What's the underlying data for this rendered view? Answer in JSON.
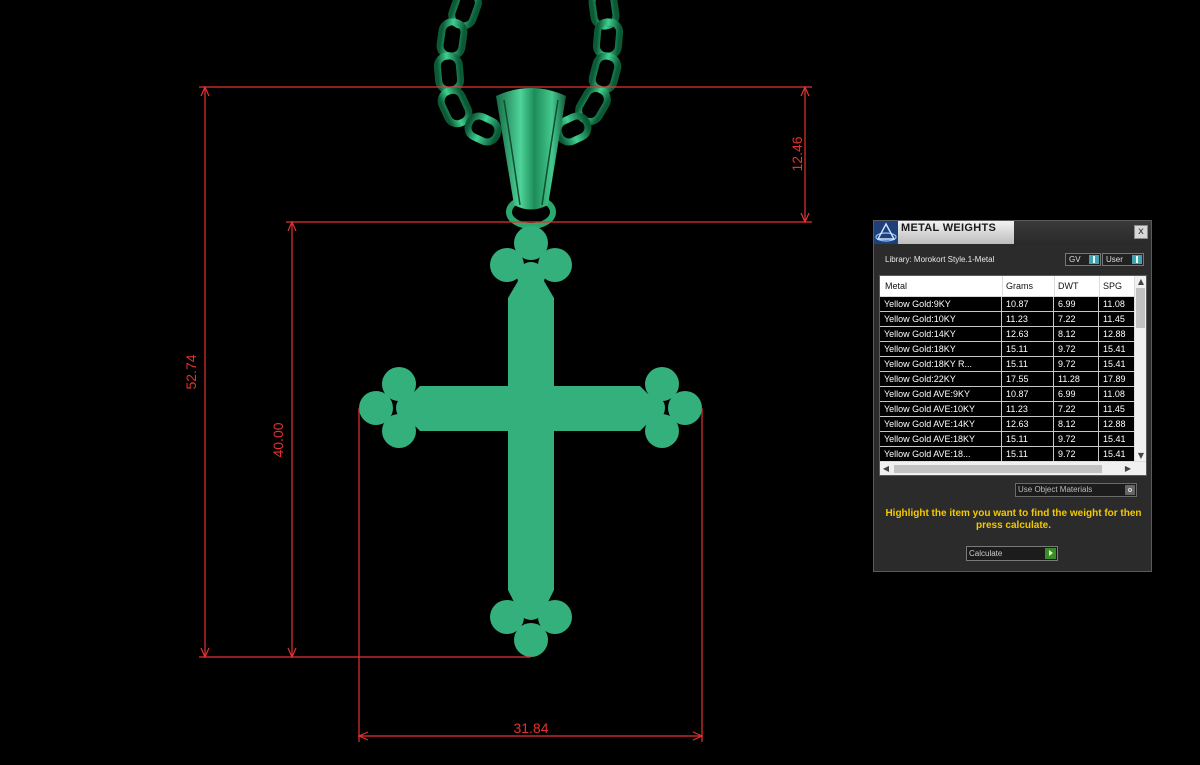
{
  "viewport": {
    "dimensions": [
      "12.46",
      "52.74",
      "40.00",
      "31.84"
    ],
    "colors": {
      "dimension": "#e23232",
      "model": "#34b07c",
      "chain": "#1a9e5e"
    }
  },
  "panel": {
    "title": "METAL WEIGHTS",
    "close_label": "x",
    "library": "Library: Morokort Style.1-Metal",
    "gv_label": "GV",
    "user_label": "User",
    "columns": [
      "Metal",
      "Grams",
      "DWT",
      "SPG"
    ],
    "rows": [
      {
        "metal": "Yellow Gold:9KY",
        "grams": "10.87",
        "dwt": "6.99",
        "spg": "11.08"
      },
      {
        "metal": "Yellow Gold:10KY",
        "grams": "11.23",
        "dwt": "7.22",
        "spg": "11.45"
      },
      {
        "metal": "Yellow Gold:14KY",
        "grams": "12.63",
        "dwt": "8.12",
        "spg": "12.88"
      },
      {
        "metal": "Yellow Gold:18KY",
        "grams": "15.11",
        "dwt": "9.72",
        "spg": "15.41"
      },
      {
        "metal": "Yellow Gold:18KY R...",
        "grams": "15.11",
        "dwt": "9.72",
        "spg": "15.41"
      },
      {
        "metal": "Yellow Gold:22KY",
        "grams": "17.55",
        "dwt": "11.28",
        "spg": "17.89"
      },
      {
        "metal": "Yellow Gold AVE:9KY",
        "grams": "10.87",
        "dwt": "6.99",
        "spg": "11.08"
      },
      {
        "metal": "Yellow Gold AVE:10KY",
        "grams": "11.23",
        "dwt": "7.22",
        "spg": "11.45"
      },
      {
        "metal": "Yellow Gold AVE:14KY",
        "grams": "12.63",
        "dwt": "8.12",
        "spg": "12.88"
      },
      {
        "metal": "Yellow Gold AVE:18KY",
        "grams": "15.11",
        "dwt": "9.72",
        "spg": "15.41"
      },
      {
        "metal": "Yellow Gold AVE:18...",
        "grams": "15.11",
        "dwt": "9.72",
        "spg": "15.41"
      }
    ],
    "use_materials_label": "Use Object Materials",
    "hint": "Highlight the item you want to find the weight for then press calculate.",
    "calculate_label": "Calculate",
    "hint_color": "#f4c900"
  }
}
